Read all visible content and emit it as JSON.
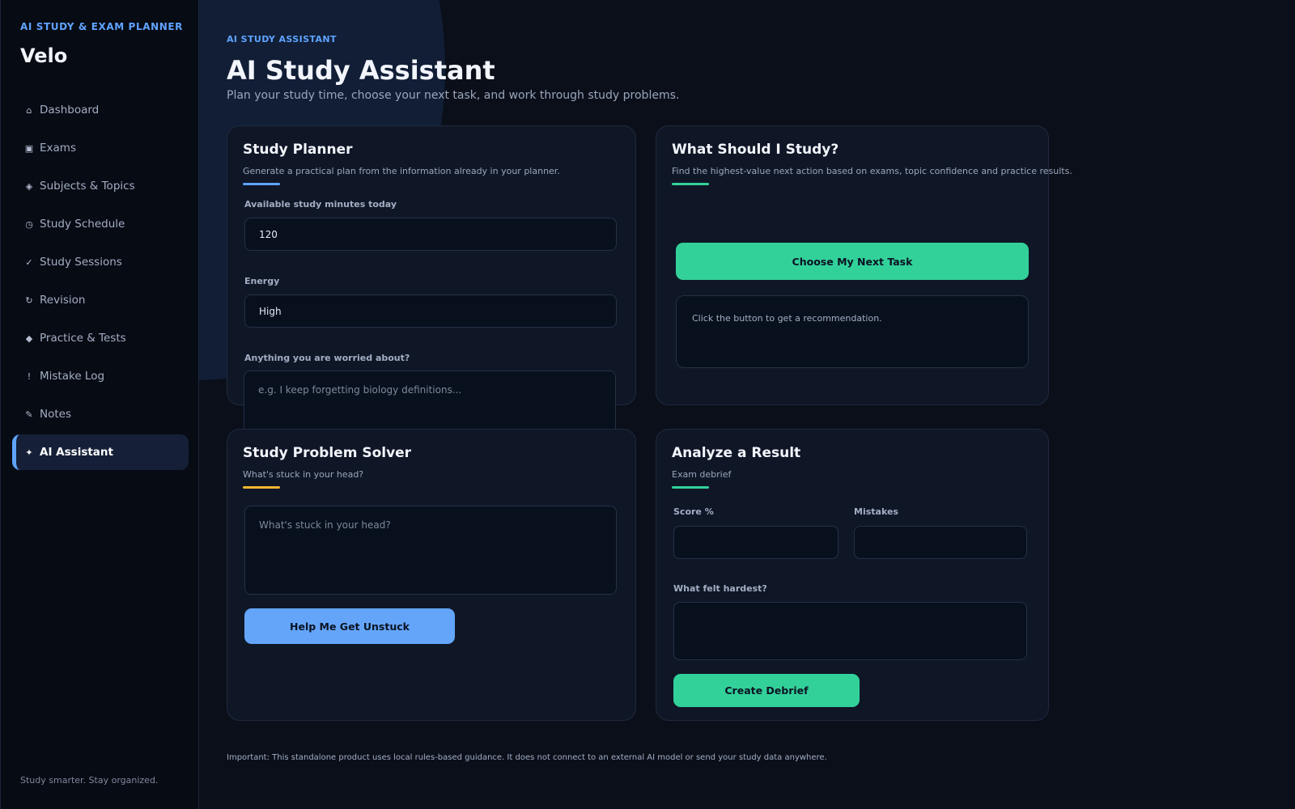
{
  "sidebar": {
    "eyebrow": "AI STUDY & EXAM PLANNER",
    "brand": "Velo",
    "items": [
      {
        "label": "Dashboard",
        "icon": "⌂"
      },
      {
        "label": "Exams",
        "icon": "▣"
      },
      {
        "label": "Subjects & Topics",
        "icon": "◈"
      },
      {
        "label": "Study Schedule",
        "icon": "◷"
      },
      {
        "label": "Study Sessions",
        "icon": "✓"
      },
      {
        "label": "Revision",
        "icon": "↻"
      },
      {
        "label": "Practice & Tests",
        "icon": "◆"
      },
      {
        "label": "Mistake Log",
        "icon": "!"
      },
      {
        "label": "Notes",
        "icon": "✎"
      },
      {
        "label": "AI Assistant",
        "icon": "✦"
      }
    ],
    "active_item": "AI Assistant",
    "footer": "Study smarter. Stay organized."
  },
  "header": {
    "eyebrow": "AI STUDY ASSISTANT",
    "title": "AI Study Assistant",
    "subtitle": "Plan your study time, choose your next task, and work through study problems."
  },
  "planner": {
    "title": "Study Planner",
    "subtitle": "Generate a practical plan from the information already in your planner.",
    "minutes_label": "Available study minutes today",
    "minutes_value": "120",
    "energy_label": "Energy",
    "energy_value": "High",
    "worried_label": "Anything you are worried about?",
    "worried_placeholder": "e.g. I keep forgetting biology definitions..."
  },
  "next_task": {
    "title": "What Should I Study?",
    "subtitle": "Find the highest-value next action based on exams, topic confidence and practice results.",
    "button": "Choose My Next Task",
    "result": "Click the button to get a recommendation."
  },
  "solver": {
    "title": "Study Problem Solver",
    "subtitle": "What's stuck in your head?",
    "placeholder": "What's stuck in your head?",
    "button": "Help Me Get Unstuck"
  },
  "analyze": {
    "title": "Analyze a Result",
    "subtitle": "Exam debrief",
    "score_label": "Score %",
    "score_value": "",
    "mistakes_label": "Mistakes",
    "mistakes_value": "",
    "hardest_label": "What felt hardest?",
    "hardest_value": "",
    "button": "Create Debrief"
  },
  "disclaimer": "Important: This standalone product uses local rules-based guidance. It does not connect to an external AI model or send your study data anywhere.",
  "colors": {
    "accent_blue": "#5fa3ff",
    "accent_green": "#33d19a",
    "accent_yellow": "#f5b731",
    "button_blue": "#64a5fa"
  }
}
